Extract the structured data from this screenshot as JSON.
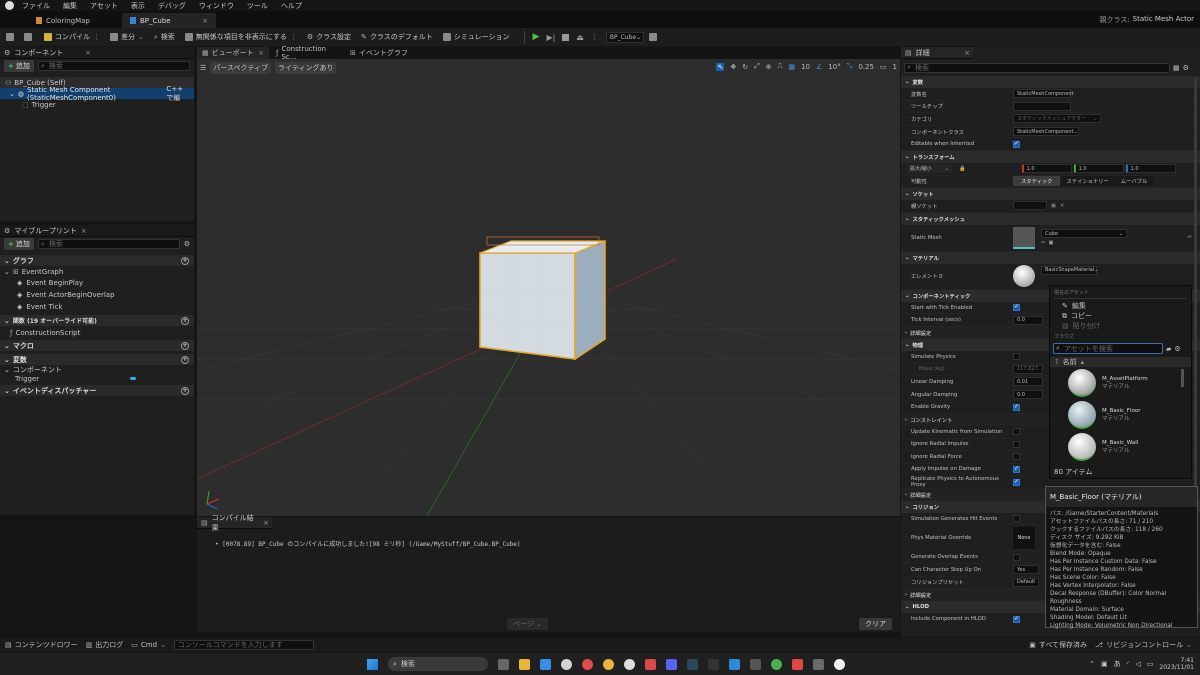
{
  "menu": [
    "ファイル",
    "編集",
    "アセット",
    "表示",
    "デバッグ",
    "ウィンドウ",
    "ツール",
    "ヘルプ"
  ],
  "doc_tabs": [
    "ColoringMap",
    "BP_Cube"
  ],
  "parent_class": {
    "label": "親クラス:",
    "value": "Static Mesh Actor"
  },
  "toolbar": {
    "compile": "コンパイル",
    "diff": "差分",
    "find": "検索",
    "hide_unrelated": "無関係な項目を非表示にする",
    "class_settings": "クラス設定",
    "class_defaults": "クラスのデフォルト",
    "simulation": "シミュレーション",
    "debug_object": "BP_Cube"
  },
  "components_panel": {
    "title": "コンポーネント",
    "add": "追加",
    "search_placeholder": "検索",
    "items": [
      "BP_Cube (Self)",
      "Static Mesh Component (StaticMeshComponent0)",
      "Trigger"
    ],
    "edit_cpp": "C++ で編"
  },
  "my_blueprint": {
    "title": "マイブループリント",
    "add": "追加",
    "search_placeholder": "検索",
    "graphs_header": "グラフ",
    "event_graph": "EventGraph",
    "events": [
      "Event BeginPlay",
      "Event ActorBeginOverlap",
      "Event Tick"
    ],
    "functions_header": "関数 (19 オーバーライド可能)",
    "construction_script": "ConstructionScript",
    "macros_header": "マクロ",
    "variables_header": "変数",
    "components_sub": "コンポーネント",
    "trigger": "Trigger",
    "dispatchers_header": "イベントディスパッチャー"
  },
  "center_tabs": [
    "ビューポート",
    "Construction Sc...",
    "イベントグラフ"
  ],
  "viewport": {
    "perspective": "パースペクティブ",
    "lit": "ライティングあり",
    "grid_snap": "10",
    "rot_snap": "10°",
    "scale_snap": "0.25",
    "cam_speed": "1"
  },
  "compiler": {
    "title": "コンパイル結果",
    "log": "[0078.89] BP_Cube のコンパイルに成功しました![98 ミリ秒] (/Game/MyStuff/BP_Cube.BP_Cube)",
    "page": "ページ",
    "clear": "クリア"
  },
  "details": {
    "title": "詳細",
    "search_placeholder": "検索",
    "sections": {
      "variable": "変数",
      "transform": "トランスフォーム",
      "sockets": "ソケット",
      "static_mesh": "スタティックメッシュ",
      "materials": "マテリアル",
      "component_tick": "コンポーネントティック",
      "advanced": "詳細設定",
      "physics": "物理",
      "constraints": "コンストレイント",
      "collision": "コリジョン",
      "hlod": "HLOD"
    },
    "variable_name": {
      "label": "変数名",
      "value": "StaticMeshComponent"
    },
    "tooltip": {
      "label": "ツールチップ"
    },
    "category": {
      "label": "カテゴリ",
      "value": "スタティックメッシュアクター"
    },
    "component_class": {
      "label": "コンポーネントクラス",
      "value": "StaticMeshComponent"
    },
    "editable_inherited": {
      "label": "Editable when Inherited"
    },
    "scale": {
      "label": "拡大/縮小",
      "x": "1.0",
      "y": "1.0",
      "z": "1.0"
    },
    "mobility": {
      "label": "可動性",
      "options": [
        "スタティック",
        "ステイショナリー",
        "ムーバブル"
      ]
    },
    "parent_socket": {
      "label": "親ソケット"
    },
    "static_mesh": {
      "label": "Static Mesh",
      "value": "Cube"
    },
    "element0": {
      "label": "エレメント 0",
      "value": "BasicShapeMaterial"
    },
    "tick_props": [
      {
        "label": "Start with Tick Enabled"
      },
      {
        "label": "Tick Interval (secs)",
        "value": "0.0"
      }
    ],
    "physics_props": [
      {
        "label": "Simulate Physics"
      },
      {
        "label": "Mass (kg)",
        "value": "117.827..."
      },
      {
        "label": "Linear Damping",
        "value": "0.01"
      },
      {
        "label": "Angular Damping",
        "value": "0.0"
      },
      {
        "label": "Enable Gravity"
      }
    ],
    "after_constraints": [
      {
        "label": "Update Kinematic from Simulation"
      },
      {
        "label": "Ignore Radial Impulse"
      },
      {
        "label": "Ignore Radial Force"
      },
      {
        "label": "Apply Impulse on Damage"
      },
      {
        "label": "Replicate Physics to Autonomous Proxy"
      }
    ],
    "collision_props": [
      {
        "label": "Simulation Generates Hit Events"
      },
      {
        "label": "Phys Material Override",
        "value": "None"
      },
      {
        "label": "Generate Overlap Events"
      },
      {
        "label": "Can Character Step Up On",
        "value": "Yes"
      },
      {
        "label": "コリジョンプリセット",
        "value": "Default"
      }
    ],
    "hlod_prop": {
      "label": "Include Component in HLOD"
    }
  },
  "asset_picker": {
    "current_asset": "現在のアセット",
    "edit": "編集",
    "copy": "コピー",
    "paste": "貼り付け",
    "browse": "ブラウズ",
    "search_placeholder": "アセットを検索",
    "name_col": "名前",
    "items": [
      {
        "name": "M_AssetPlatform",
        "type": "マテリアル"
      },
      {
        "name": "M_Basic_Floor",
        "type": "マテリアル"
      },
      {
        "name": "M_Basic_Wall",
        "type": "マテリアル"
      }
    ],
    "count": "80 アイテム"
  },
  "tooltip_popup": {
    "title": "M_Basic_Floor (マテリアル)",
    "lines": [
      "パス: /Game/StarterContent/Materials",
      "アセットファイルパスの長さ: 71 / 210",
      "クックするファイルパスの長さ: 118 / 260",
      "ディスク サイズ: 9.292 KiB",
      "仮想化データを含む: False",
      "Blend Mode: Opaque",
      "Has Per Instance Custom Data: False",
      "Has Per Instance Random: False",
      "Has Scene Color: False",
      "Has Vertex Interpolator: False",
      "Decal Response (DBuffer): Color Normal Roughness",
      "Material Domain: Surface",
      "Shading Model: Default Lit",
      "Lighting Mode: Volumetric Non Directional"
    ]
  },
  "bottom_bar": {
    "content_drawer": "コンテンツドロワー",
    "output_log": "出力ログ",
    "cmd": "Cmd",
    "console_placeholder": "コンソールコマンドを入力します",
    "save_all": "すべて保存済み",
    "revision": "リビジョンコントロール"
  },
  "taskbar": {
    "search": "検索",
    "time": "7:41",
    "date": "2023/11/01"
  }
}
